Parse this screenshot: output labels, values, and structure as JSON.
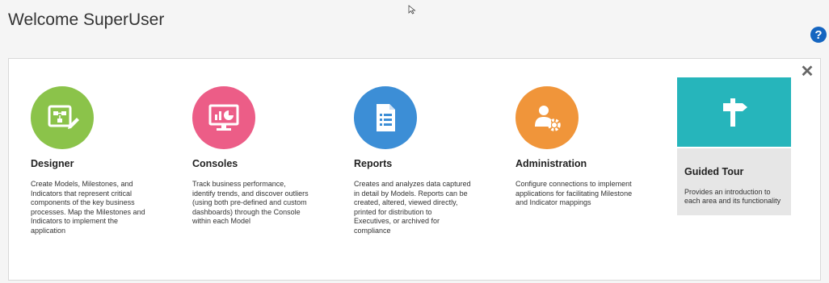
{
  "page": {
    "title": "Welcome SuperUser"
  },
  "help": {
    "label": "?",
    "icon": "help-icon"
  },
  "panel": {
    "close_label": "✕"
  },
  "cards": [
    {
      "title": "Designer",
      "description": "Create Models, Milestones, and Indicators that represent critical components of the key business processes. Map the Milestones and Indicators to implement the application",
      "icon": "designer-icon",
      "color": "#8bc34a"
    },
    {
      "title": "Consoles",
      "description": "Track business performance, identify trends, and discover outliers (using both pre-defined and custom dashboards) through the Console within each Model",
      "icon": "console-monitor-icon",
      "color": "#ec5d87"
    },
    {
      "title": "Reports",
      "description": "Creates and analyzes data captured in detail by Models. Reports can be created, altered, viewed directly, printed for distribution to Executives, or archived for compliance",
      "icon": "report-document-icon",
      "color": "#3c8ed6"
    },
    {
      "title": "Administration",
      "description": "Configure connections to implement applications for facilitating Milestone and Indicator mappings",
      "icon": "admin-user-gear-icon",
      "color": "#f0953a"
    }
  ],
  "guided_tour": {
    "title": "Guided Tour",
    "description": "Provides an introduction to each area and its functionality",
    "icon": "signpost-icon",
    "color": "#26b5bb"
  }
}
